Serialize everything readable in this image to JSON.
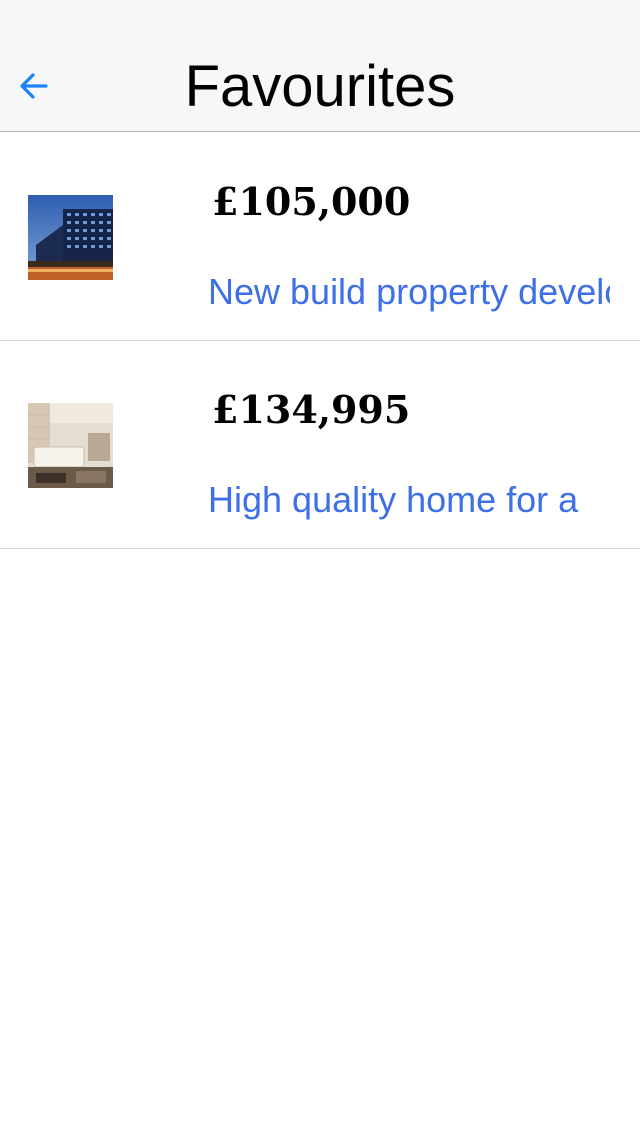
{
  "nav": {
    "title": "Favourites",
    "back_icon": "back-arrow-icon",
    "accent_color": "#1a82fb"
  },
  "listings": [
    {
      "price": "£105,000",
      "description": "New build property development",
      "thumbnail": "apartment-building"
    },
    {
      "price": "£134,995",
      "description": "High quality home for a",
      "thumbnail": "bathroom-interior"
    }
  ],
  "colors": {
    "description_link": "#3d6fe6",
    "nav_background": "#f7f7f7"
  }
}
